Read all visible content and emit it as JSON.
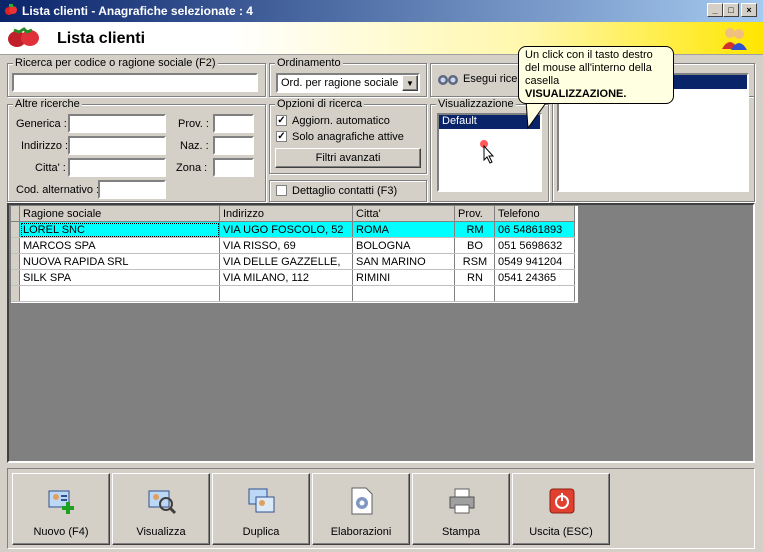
{
  "window": {
    "title": "Lista clienti - Anagrafiche selezionate : 4"
  },
  "header": {
    "title": "Lista clienti",
    "logo_icon": "strawberry-icon",
    "users_icon": "users-icon"
  },
  "search": {
    "label": "Ricerca per codice o ragione sociale (F2)",
    "value": ""
  },
  "ordering": {
    "label": "Ordinamento",
    "selected": "Ord. per ragione sociale"
  },
  "execute": {
    "label": "Esegui ricerca"
  },
  "other_searches": {
    "label": "Altre ricerche",
    "generica": "Generica :",
    "indirizzo": "Indirizzo :",
    "citta": "Citta' :",
    "cod_alternativo": "Cod. alternativo :",
    "prov": "Prov. :",
    "naz": "Naz. :",
    "zona": "Zona :"
  },
  "options": {
    "label": "Opzioni di ricerca",
    "auto_update": "Aggiorn. automatico",
    "active_only": "Solo anagrafiche attive",
    "advanced_filters": "Filtri avanzati"
  },
  "contacts_detail": {
    "label": "Dettaglio contatti (F3)"
  },
  "display": {
    "label": "Visualizzazione",
    "items": [
      "Default"
    ]
  },
  "tooltip": {
    "line1": "Un click con il tasto destro",
    "line2": "del mouse all'interno della",
    "line3": "casella",
    "line4": "VISUALIZZAZIONE."
  },
  "table": {
    "headers": [
      "Ragione sociale",
      "Indirizzo",
      "Citta'",
      "Prov.",
      "Telefono"
    ],
    "rows": [
      [
        "LOREL SNC",
        "VIA UGO FOSCOLO, 52",
        "ROMA",
        "RM",
        "06 54861893"
      ],
      [
        "MARCOS SPA",
        "VIA RISSO, 69",
        "BOLOGNA",
        "BO",
        "051 5698632"
      ],
      [
        "NUOVA RAPIDA SRL",
        "VIA DELLE GAZZELLE,",
        "SAN MARINO",
        "RSM",
        "0549 941204"
      ],
      [
        "SILK SPA",
        "VIA MILANO, 112",
        "RIMINI",
        "RN",
        "0541 24365"
      ]
    ]
  },
  "buttons": {
    "new": "Nuovo (F4)",
    "view": "Visualizza",
    "duplicate": "Duplica",
    "process": "Elaborazioni",
    "print": "Stampa",
    "exit": "Uscita (ESC)"
  },
  "colors": {
    "selected_row": "#00ffff",
    "title_bar": "#0a246a",
    "header_gradient_end": "#ffe600"
  }
}
